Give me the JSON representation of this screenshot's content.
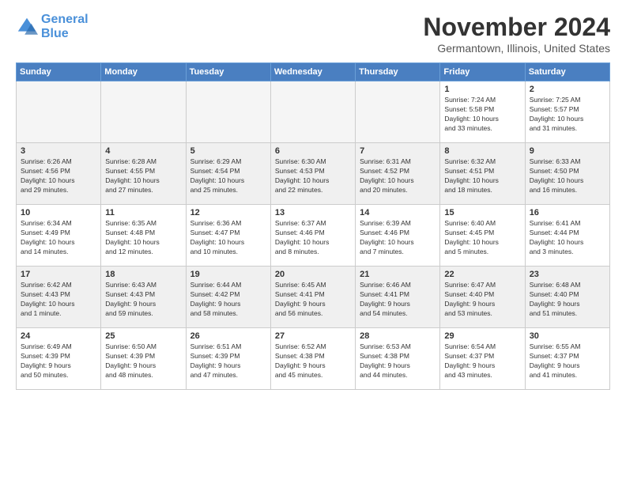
{
  "logo": {
    "line1": "General",
    "line2": "Blue"
  },
  "header": {
    "month": "November 2024",
    "location": "Germantown, Illinois, United States"
  },
  "weekdays": [
    "Sunday",
    "Monday",
    "Tuesday",
    "Wednesday",
    "Thursday",
    "Friday",
    "Saturday"
  ],
  "weeks": [
    [
      {
        "day": "",
        "info": "",
        "empty": true
      },
      {
        "day": "",
        "info": "",
        "empty": true
      },
      {
        "day": "",
        "info": "",
        "empty": true
      },
      {
        "day": "",
        "info": "",
        "empty": true
      },
      {
        "day": "",
        "info": "",
        "empty": true
      },
      {
        "day": "1",
        "info": "Sunrise: 7:24 AM\nSunset: 5:58 PM\nDaylight: 10 hours\nand 33 minutes."
      },
      {
        "day": "2",
        "info": "Sunrise: 7:25 AM\nSunset: 5:57 PM\nDaylight: 10 hours\nand 31 minutes."
      }
    ],
    [
      {
        "day": "3",
        "info": "Sunrise: 6:26 AM\nSunset: 4:56 PM\nDaylight: 10 hours\nand 29 minutes."
      },
      {
        "day": "4",
        "info": "Sunrise: 6:28 AM\nSunset: 4:55 PM\nDaylight: 10 hours\nand 27 minutes."
      },
      {
        "day": "5",
        "info": "Sunrise: 6:29 AM\nSunset: 4:54 PM\nDaylight: 10 hours\nand 25 minutes."
      },
      {
        "day": "6",
        "info": "Sunrise: 6:30 AM\nSunset: 4:53 PM\nDaylight: 10 hours\nand 22 minutes."
      },
      {
        "day": "7",
        "info": "Sunrise: 6:31 AM\nSunset: 4:52 PM\nDaylight: 10 hours\nand 20 minutes."
      },
      {
        "day": "8",
        "info": "Sunrise: 6:32 AM\nSunset: 4:51 PM\nDaylight: 10 hours\nand 18 minutes."
      },
      {
        "day": "9",
        "info": "Sunrise: 6:33 AM\nSunset: 4:50 PM\nDaylight: 10 hours\nand 16 minutes."
      }
    ],
    [
      {
        "day": "10",
        "info": "Sunrise: 6:34 AM\nSunset: 4:49 PM\nDaylight: 10 hours\nand 14 minutes."
      },
      {
        "day": "11",
        "info": "Sunrise: 6:35 AM\nSunset: 4:48 PM\nDaylight: 10 hours\nand 12 minutes."
      },
      {
        "day": "12",
        "info": "Sunrise: 6:36 AM\nSunset: 4:47 PM\nDaylight: 10 hours\nand 10 minutes."
      },
      {
        "day": "13",
        "info": "Sunrise: 6:37 AM\nSunset: 4:46 PM\nDaylight: 10 hours\nand 8 minutes."
      },
      {
        "day": "14",
        "info": "Sunrise: 6:39 AM\nSunset: 4:46 PM\nDaylight: 10 hours\nand 7 minutes."
      },
      {
        "day": "15",
        "info": "Sunrise: 6:40 AM\nSunset: 4:45 PM\nDaylight: 10 hours\nand 5 minutes."
      },
      {
        "day": "16",
        "info": "Sunrise: 6:41 AM\nSunset: 4:44 PM\nDaylight: 10 hours\nand 3 minutes."
      }
    ],
    [
      {
        "day": "17",
        "info": "Sunrise: 6:42 AM\nSunset: 4:43 PM\nDaylight: 10 hours\nand 1 minute."
      },
      {
        "day": "18",
        "info": "Sunrise: 6:43 AM\nSunset: 4:43 PM\nDaylight: 9 hours\nand 59 minutes."
      },
      {
        "day": "19",
        "info": "Sunrise: 6:44 AM\nSunset: 4:42 PM\nDaylight: 9 hours\nand 58 minutes."
      },
      {
        "day": "20",
        "info": "Sunrise: 6:45 AM\nSunset: 4:41 PM\nDaylight: 9 hours\nand 56 minutes."
      },
      {
        "day": "21",
        "info": "Sunrise: 6:46 AM\nSunset: 4:41 PM\nDaylight: 9 hours\nand 54 minutes."
      },
      {
        "day": "22",
        "info": "Sunrise: 6:47 AM\nSunset: 4:40 PM\nDaylight: 9 hours\nand 53 minutes."
      },
      {
        "day": "23",
        "info": "Sunrise: 6:48 AM\nSunset: 4:40 PM\nDaylight: 9 hours\nand 51 minutes."
      }
    ],
    [
      {
        "day": "24",
        "info": "Sunrise: 6:49 AM\nSunset: 4:39 PM\nDaylight: 9 hours\nand 50 minutes."
      },
      {
        "day": "25",
        "info": "Sunrise: 6:50 AM\nSunset: 4:39 PM\nDaylight: 9 hours\nand 48 minutes."
      },
      {
        "day": "26",
        "info": "Sunrise: 6:51 AM\nSunset: 4:39 PM\nDaylight: 9 hours\nand 47 minutes."
      },
      {
        "day": "27",
        "info": "Sunrise: 6:52 AM\nSunset: 4:38 PM\nDaylight: 9 hours\nand 45 minutes."
      },
      {
        "day": "28",
        "info": "Sunrise: 6:53 AM\nSunset: 4:38 PM\nDaylight: 9 hours\nand 44 minutes."
      },
      {
        "day": "29",
        "info": "Sunrise: 6:54 AM\nSunset: 4:37 PM\nDaylight: 9 hours\nand 43 minutes."
      },
      {
        "day": "30",
        "info": "Sunrise: 6:55 AM\nSunset: 4:37 PM\nDaylight: 9 hours\nand 41 minutes."
      }
    ]
  ]
}
